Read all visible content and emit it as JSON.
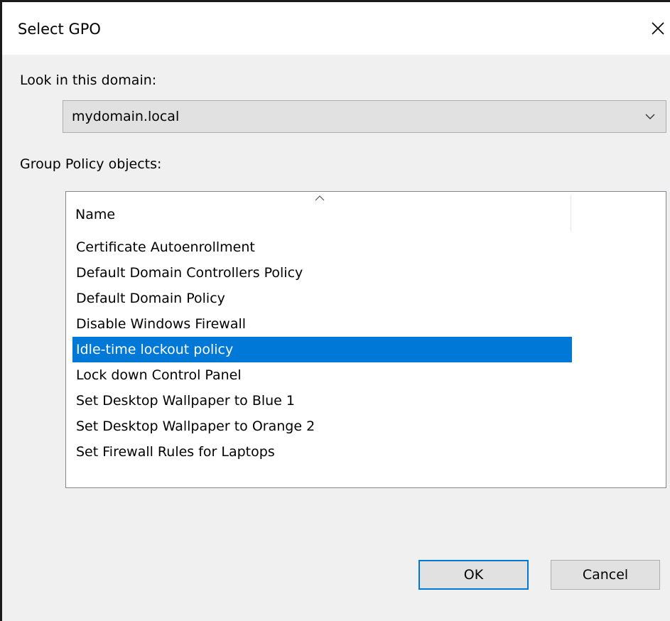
{
  "dialog": {
    "title": "Select GPO",
    "close_icon": "close-icon"
  },
  "domain": {
    "label": "Look in this domain:",
    "selected": "mydomain.local"
  },
  "gpo_list": {
    "label": "Group Policy objects:",
    "column_header": "Name",
    "sort": "ascending",
    "items": [
      "Certificate Autoenrollment",
      "Default Domain Controllers Policy",
      "Default Domain Policy",
      "Disable Windows Firewall",
      "Idle-time lockout policy",
      "Lock down Control Panel",
      "Set Desktop Wallpaper to Blue 1",
      "Set Desktop Wallpaper to Orange 2",
      "Set Firewall Rules for Laptops"
    ],
    "selected_index": 4
  },
  "buttons": {
    "ok_label": "OK",
    "cancel_label": "Cancel"
  },
  "colors": {
    "selection": "#0078d7",
    "default_button_border": "#0078d7",
    "dialog_background": "#f0f0f0"
  }
}
